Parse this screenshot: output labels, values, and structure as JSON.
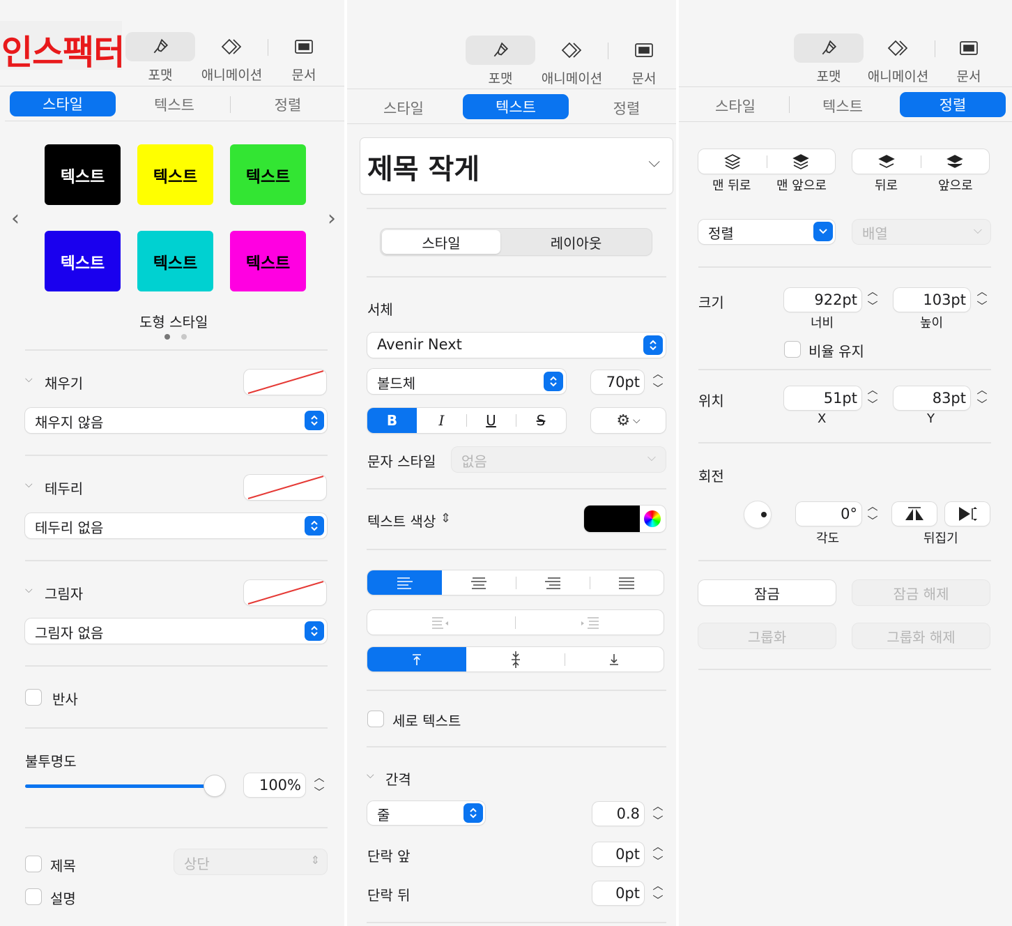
{
  "colors": {
    "accent": "#0a74f0",
    "title_red": "#e8191b",
    "panel_bg": "#f5f5f5",
    "slash": "#e53935"
  },
  "p1": {
    "title": "인스팩터",
    "toolbar": {
      "format": "포맷",
      "animate": "애니메이션",
      "document": "문서"
    },
    "tabs": {
      "style": "스타일",
      "text": "텍스트",
      "arrange": "정렬"
    },
    "swatches": [
      {
        "label": "텍스트",
        "bg": "#000000",
        "fg": "#ffffff"
      },
      {
        "label": "텍스트",
        "bg": "#ffff00",
        "fg": "#000000"
      },
      {
        "label": "텍스트",
        "bg": "#33e533",
        "fg": "#000000"
      },
      {
        "label": "텍스트",
        "bg": "#1a00ee",
        "fg": "#ffffff"
      },
      {
        "label": "텍스트",
        "bg": "#00d1d1",
        "fg": "#000000"
      },
      {
        "label": "텍스트",
        "bg": "#ff00e1",
        "fg": "#000000"
      }
    ],
    "shape_style": "도형 스타일",
    "fill": {
      "label": "채우기",
      "value": "채우지 않음"
    },
    "border": {
      "label": "테두리",
      "value": "테두리 없음"
    },
    "shadow": {
      "label": "그림자",
      "value": "그림자 없음"
    },
    "reflection": "반사",
    "opacity": {
      "label": "불투명도",
      "value": "100%",
      "level": 1.0
    },
    "caption": {
      "title": "제목",
      "title_pos": "상단",
      "description": "설명"
    }
  },
  "p2": {
    "toolbar": {
      "format": "포맷",
      "animate": "애니메이션",
      "document": "문서"
    },
    "tabs": {
      "style": "스타일",
      "text": "텍스트",
      "arrange": "정렬"
    },
    "para_style": "제목 작게",
    "seg": {
      "style": "스타일",
      "layout": "레이아웃"
    },
    "font_label": "서체",
    "font_name": "Avenir Next",
    "font_weight": "볼드체",
    "font_size": "70pt",
    "bius": {
      "b": "B",
      "i": "I",
      "u": "U",
      "s": "S"
    },
    "char_style": {
      "label": "문자 스타일",
      "value": "없음"
    },
    "text_color": "텍스트 색상",
    "vertical_text": "세로 텍스트",
    "spacing": {
      "label": "간격",
      "line_mode": "줄",
      "line_value": "0.8",
      "before_label": "단락 앞",
      "before_value": "0pt",
      "after_label": "단락 뒤",
      "after_value": "0pt"
    }
  },
  "p3": {
    "toolbar": {
      "format": "포맷",
      "animate": "애니메이션",
      "document": "문서"
    },
    "tabs": {
      "style": "스타일",
      "text": "텍스트",
      "arrange": "정렬"
    },
    "order": {
      "back": "맨 뒤로",
      "front": "맨 앞으로",
      "backward": "뒤로",
      "forward": "앞으로"
    },
    "align": "정렬",
    "distribute": "배열",
    "size": {
      "label": "크기",
      "width": "922pt",
      "width_label": "너비",
      "height": "103pt",
      "height_label": "높이",
      "constrain": "비율 유지"
    },
    "position": {
      "label": "위치",
      "x": "51pt",
      "x_label": "X",
      "y": "83pt",
      "y_label": "Y"
    },
    "rotate": {
      "label": "회전",
      "angle": "0°",
      "angle_label": "각도",
      "flip_label": "뒤집기"
    },
    "lock": "잠금",
    "unlock": "잠금 해제",
    "group": "그룹화",
    "ungroup": "그룹화 해제"
  }
}
